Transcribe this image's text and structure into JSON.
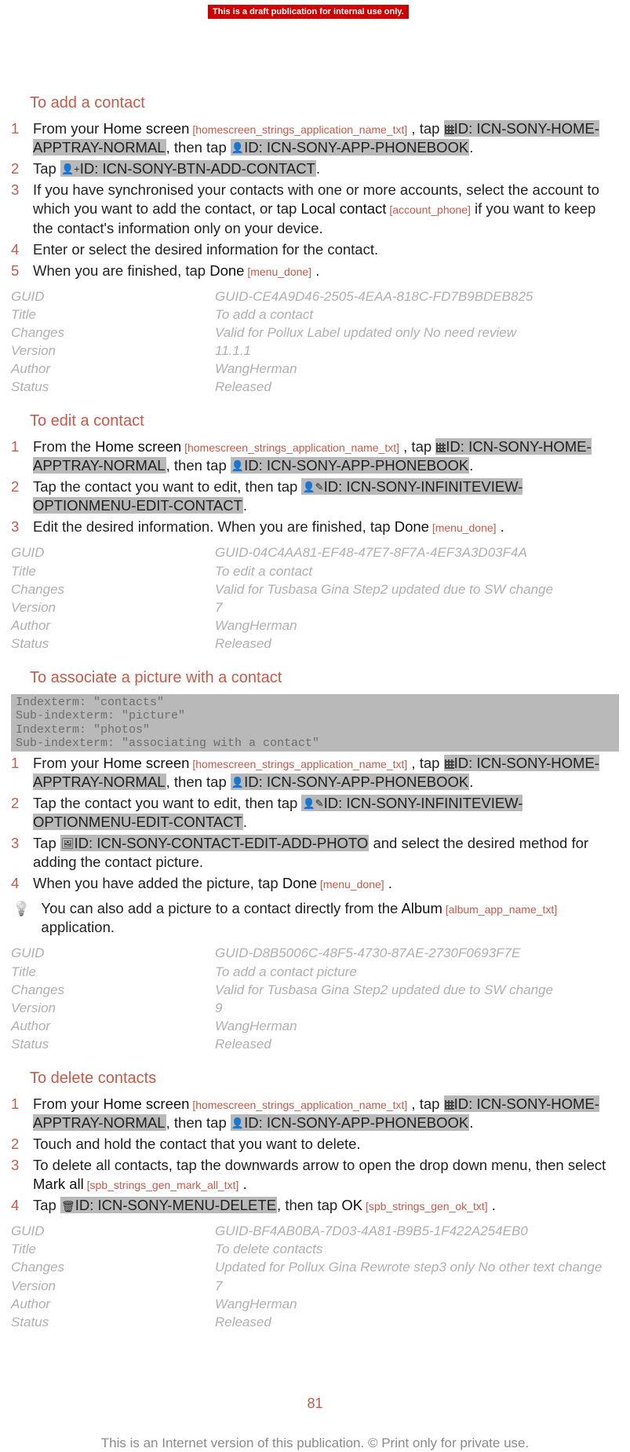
{
  "banner": "This is a draft publication for internal use only.",
  "page_number": "81",
  "footer_text": "This is an Internet version of this publication. © Print only for private use.",
  "section_add": {
    "heading": "To add a contact",
    "s1_a": "From your ",
    "s1_home": "Home screen",
    "s1_home_tag": " [homescreen_strings_application_name_txt]",
    "s1_b": " , tap ",
    "s1_apptray": "ID: ICN-SONY-HOME-APPTRAY-NORMAL",
    "s1_c": ", then tap ",
    "s1_phonebook": "ID: ICN-SONY-APP-PHONEBOOK",
    "s1_d": ".",
    "s2_a": "Tap ",
    "s2_add": "ID: ICN-SONY-BTN-ADD-CONTACT",
    "s2_b": ".",
    "s3_a": "If you have synchronised your contacts with one or more accounts, select the account to which you want to add the contact, or tap ",
    "s3_local": "Local contact",
    "s3_local_tag": " [account_phone]",
    "s3_b": " if you want to keep the contact's information only on your device.",
    "s4": "Enter or select the desired information for the contact.",
    "s5_a": "When you are finished, tap ",
    "s5_done": "Done",
    "s5_done_tag": " [menu_done]",
    "s5_b": " .",
    "meta": {
      "guid_l": "GUID",
      "guid_v": "GUID-CE4A9D46-2505-4EAA-818C-FD7B9BDEB825",
      "title_l": "Title",
      "title_v": "To add a contact",
      "changes_l": "Changes",
      "changes_v": "Valid for Pollux Label updated only No need review",
      "version_l": "Version",
      "version_v": "11.1.1",
      "author_l": "Author",
      "author_v": "WangHerman",
      "status_l": "Status",
      "status_v": "Released"
    }
  },
  "section_edit": {
    "heading": "To edit a contact",
    "s1_a": "From the ",
    "s1_home": "Home screen",
    "s1_home_tag": " [homescreen_strings_application_name_txt]",
    "s1_b": " , tap ",
    "s1_apptray": "ID: ICN-SONY-HOME-APPTRAY-NORMAL",
    "s1_c": ", then tap ",
    "s1_phonebook": "ID: ICN-SONY-APP-PHONEBOOK",
    "s1_d": ".",
    "s2_a": "Tap the contact you want to edit, then tap ",
    "s2_edit": "ID: ICN-SONY-INFINITEVIEW-OPTIONMENU-EDIT-CONTACT",
    "s2_b": ".",
    "s3_a": "Edit the desired information. When you are finished, tap ",
    "s3_done": "Done",
    "s3_done_tag": " [menu_done]",
    "s3_b": " .",
    "meta": {
      "guid_l": "GUID",
      "guid_v": "GUID-04C4AA81-EF48-47E7-8F7A-4EF3A3D03F4A",
      "title_l": "Title",
      "title_v": "To edit a contact",
      "changes_l": "Changes",
      "changes_v": "Valid for Tusbasa Gina Step2 updated due to SW change",
      "version_l": "Version",
      "version_v": "7",
      "author_l": "Author",
      "author_v": "WangHerman",
      "status_l": "Status",
      "status_v": "Released"
    }
  },
  "section_pic": {
    "heading": "To associate a picture with a contact",
    "index_block": "Indexterm: \"contacts\"\nSub-indexterm: \"picture\"\nIndexterm: \"photos\"\nSub-indexterm: \"associating with a contact\"",
    "s1_a": "From your ",
    "s1_home": "Home screen",
    "s1_home_tag": " [homescreen_strings_application_name_txt]",
    "s1_b": " , tap ",
    "s1_apptray": "ID: ICN-SONY-HOME-APPTRAY-NORMAL",
    "s1_c": ", then tap ",
    "s1_phonebook": "ID: ICN-SONY-APP-PHONEBOOK",
    "s1_d": ".",
    "s2_a": "Tap the contact you want to edit, then tap ",
    "s2_edit": "ID: ICN-SONY-INFINITEVIEW-OPTIONMENU-EDIT-CONTACT",
    "s2_b": ".",
    "s3_a": "Tap ",
    "s3_photo": "ID: ICN-SONY-CONTACT-EDIT-ADD-PHOTO",
    "s3_b": " and select the desired method for adding the contact picture.",
    "s4_a": "When you have added the picture, tap ",
    "s4_done": "Done",
    "s4_done_tag": " [menu_done]",
    "s4_b": " .",
    "tip_a": "You can also add a picture to a contact directly from the ",
    "tip_album": "Album",
    "tip_album_tag": " [album_app_name_txt]",
    "tip_b": " application.",
    "meta": {
      "guid_l": "GUID",
      "guid_v": "GUID-D8B5006C-48F5-4730-87AE-2730F0693F7E",
      "title_l": "Title",
      "title_v": "To add a contact picture",
      "changes_l": "Changes",
      "changes_v": "Valid for Tusbasa Gina Step2 updated due to SW change",
      "version_l": "Version",
      "version_v": "9",
      "author_l": "Author",
      "author_v": "WangHerman",
      "status_l": "Status",
      "status_v": "Released"
    }
  },
  "section_del": {
    "heading": "To delete contacts",
    "s1_a": "From your ",
    "s1_home": "Home screen",
    "s1_home_tag": " [homescreen_strings_application_name_txt]",
    "s1_b": " , tap ",
    "s1_apptray": "ID: ICN-SONY-HOME-APPTRAY-NORMAL",
    "s1_c": ", then tap ",
    "s1_phonebook": "ID: ICN-SONY-APP-PHONEBOOK",
    "s1_d": ".",
    "s2": "Touch and hold the contact that you want to delete.",
    "s3_a": "To delete all contacts, tap the downwards arrow to open the drop down menu, then select ",
    "s3_mark": "Mark all",
    "s3_mark_tag": " [spb_strings_gen_mark_all_txt]",
    "s3_b": " .",
    "s4_a": "Tap ",
    "s4_del": "ID: ICN-SONY-MENU-DELETE",
    "s4_b": ", then tap ",
    "s4_ok": "OK",
    "s4_ok_tag": " [spb_strings_gen_ok_txt]",
    "s4_c": " .",
    "meta": {
      "guid_l": "GUID",
      "guid_v": "GUID-BF4AB0BA-7D03-4A81-B9B5-1F422A254EB0",
      "title_l": "Title",
      "title_v": "To delete contacts",
      "changes_l": "Changes",
      "changes_v": "Updated for Pollux Gina Rewrote step3 only No other text change",
      "version_l": "Version",
      "version_v": "7",
      "author_l": "Author",
      "author_v": "WangHerman",
      "status_l": "Status",
      "status_v": "Released"
    }
  }
}
